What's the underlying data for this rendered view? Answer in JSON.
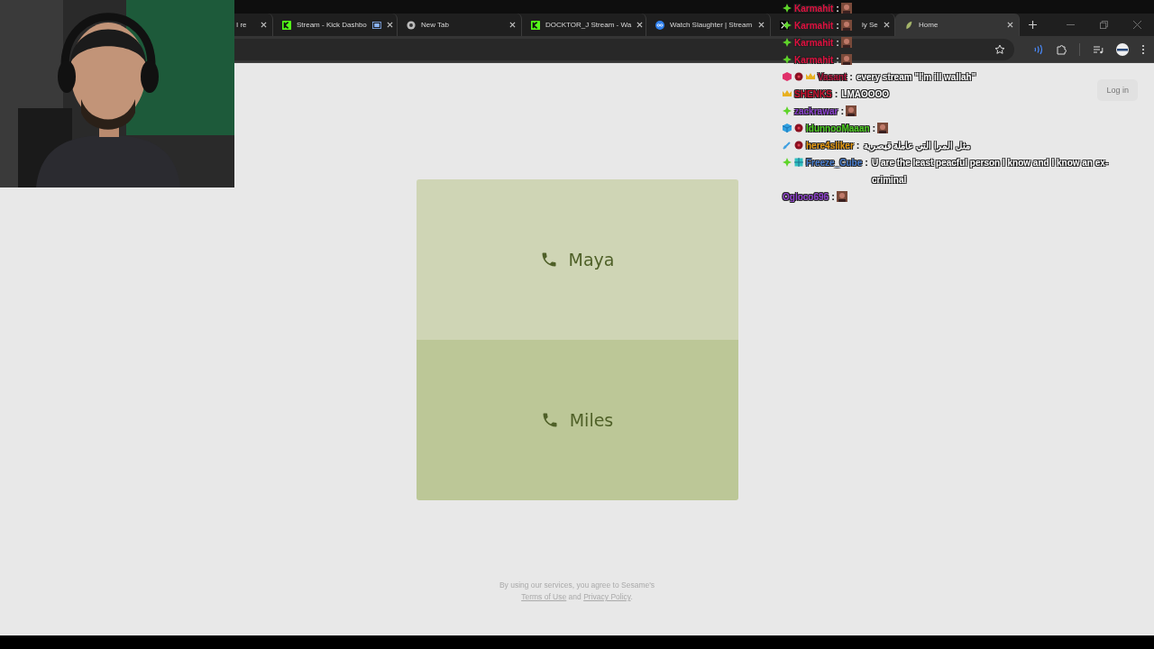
{
  "tabs": [
    {
      "title": "I re",
      "kind": "plain",
      "selected": false
    },
    {
      "title": "Stream - Kick Dashbo",
      "kind": "kick_shared",
      "selected": false
    },
    {
      "title": "New Tab",
      "kind": "newtab",
      "selected": false
    },
    {
      "title": "DOCKTOR_J Stream - Wa",
      "kind": "kick",
      "selected": false
    },
    {
      "title": "Watch Slaughter | Stream",
      "kind": "stream",
      "selected": false
    },
    {
      "title": "ly Se",
      "kind": "x",
      "selected": false
    },
    {
      "title": "Home",
      "kind": "leaf",
      "selected": true
    }
  ],
  "page": {
    "login": "Log in",
    "agents": [
      {
        "name": "Maya",
        "color": "#cfd5b5"
      },
      {
        "name": "Miles",
        "color": "#bcc797"
      }
    ],
    "footer": {
      "before": "By using our services, you agree to Sesame's ",
      "terms": "Terms of Use",
      "middle": " and ",
      "privacy": "Privacy Policy",
      "end": "."
    }
  },
  "chat": [
    {
      "user": "Karmahit",
      "color": "#e0103f",
      "badges": [
        {
          "kind": "diamond"
        }
      ],
      "sep": ":",
      "emote": true
    },
    {
      "user": "Karmahit",
      "color": "#e0103f",
      "badges": [
        {
          "kind": "diamond"
        }
      ],
      "sep": ":",
      "emote": true
    },
    {
      "user": "Karmahit",
      "color": "#e0103f",
      "badges": [
        {
          "kind": "diamond"
        }
      ],
      "sep": ":",
      "emote": true
    },
    {
      "user": "Karmahit",
      "color": "#e0103f",
      "badges": [
        {
          "kind": "diamond"
        }
      ],
      "sep": ":",
      "emote": true
    },
    {
      "user": "Vasant",
      "color": "#b0103a",
      "badges": [
        {
          "kind": "gem"
        },
        {
          "kind": "dot"
        },
        {
          "kind": "crown"
        }
      ],
      "sep": ":",
      "message": "every stream \"I'm ill wallah\""
    },
    {
      "user": "SHENKS",
      "color": "#c8102e",
      "badges": [
        {
          "kind": "crown"
        }
      ],
      "sep": ":",
      "message": "LMAOOOO"
    },
    {
      "user": "zackrawar",
      "color": "#8a3fd0",
      "badges": [
        {
          "kind": "diamond"
        }
      ],
      "sep": ":",
      "emote": true
    },
    {
      "user": "IdunnooMaaan",
      "color": "#4ccf20",
      "badges": [
        {
          "kind": "cube"
        },
        {
          "kind": "dot"
        }
      ],
      "sep": ":",
      "emote": true
    },
    {
      "user": "here4sliker",
      "color": "#e89a10",
      "badges": [
        {
          "kind": "sword"
        },
        {
          "kind": "dot"
        }
      ],
      "sep": ":",
      "message": "مثل المرا التي عاملة قيصرية"
    },
    {
      "user": "Freeze_Cube",
      "color": "#4a7fd0",
      "badges": [
        {
          "kind": "diamond"
        },
        {
          "kind": "gift"
        }
      ],
      "sep": ":",
      "message": "U are the least peacful person I know and I know an ex-criminal"
    },
    {
      "user": "Ogloco696",
      "color": "#9040d0",
      "sep": ":",
      "emote": true
    }
  ]
}
